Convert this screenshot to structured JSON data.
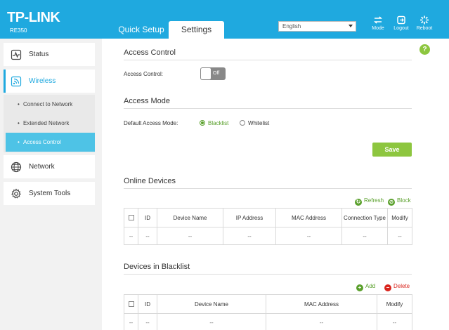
{
  "header": {
    "logo": "TP-LINK",
    "model": "RE350",
    "tabs": [
      {
        "label": "Quick Setup",
        "active": false
      },
      {
        "label": "Settings",
        "active": true
      }
    ],
    "language": "English",
    "buttons": {
      "mode": "Mode",
      "logout": "Logout",
      "reboot": "Reboot"
    },
    "accent_color": "#1fa9df"
  },
  "sidebar": {
    "items": [
      {
        "label": "Status",
        "icon": "status-icon"
      },
      {
        "label": "Wireless",
        "icon": "wireless-icon",
        "active": true
      },
      {
        "label": "Network",
        "icon": "globe-icon"
      },
      {
        "label": "System Tools",
        "icon": "gear-icon"
      }
    ],
    "sub_items": [
      {
        "label": "Connect to Network"
      },
      {
        "label": "Extended Network"
      },
      {
        "label": "Access Control",
        "active": true
      }
    ]
  },
  "main": {
    "help": "?",
    "access_control": {
      "title": "Access Control",
      "label": "Access Control:",
      "toggle_state": "Off"
    },
    "access_mode": {
      "title": "Access Mode",
      "label": "Default Access Mode:",
      "options": [
        "Blacklist",
        "Whitelist"
      ],
      "selected": "Blacklist"
    },
    "save_label": "Save",
    "online_devices": {
      "title": "Online Devices",
      "actions": {
        "refresh": "Refresh",
        "block": "Block"
      },
      "columns": [
        "ID",
        "Device Name",
        "IP Address",
        "MAC Address",
        "Connection Type",
        "Modify"
      ],
      "row": [
        "--",
        "--",
        "--",
        "--",
        "--",
        "--",
        "--"
      ]
    },
    "blacklist": {
      "title": "Devices in Blacklist",
      "actions": {
        "add": "Add",
        "delete": "Delete"
      },
      "columns": [
        "ID",
        "Device Name",
        "MAC Address",
        "Modify"
      ],
      "row": [
        "--",
        "--",
        "--",
        "--",
        "--"
      ]
    },
    "green_color": "#8dc63f",
    "red_color": "#d9241c"
  }
}
